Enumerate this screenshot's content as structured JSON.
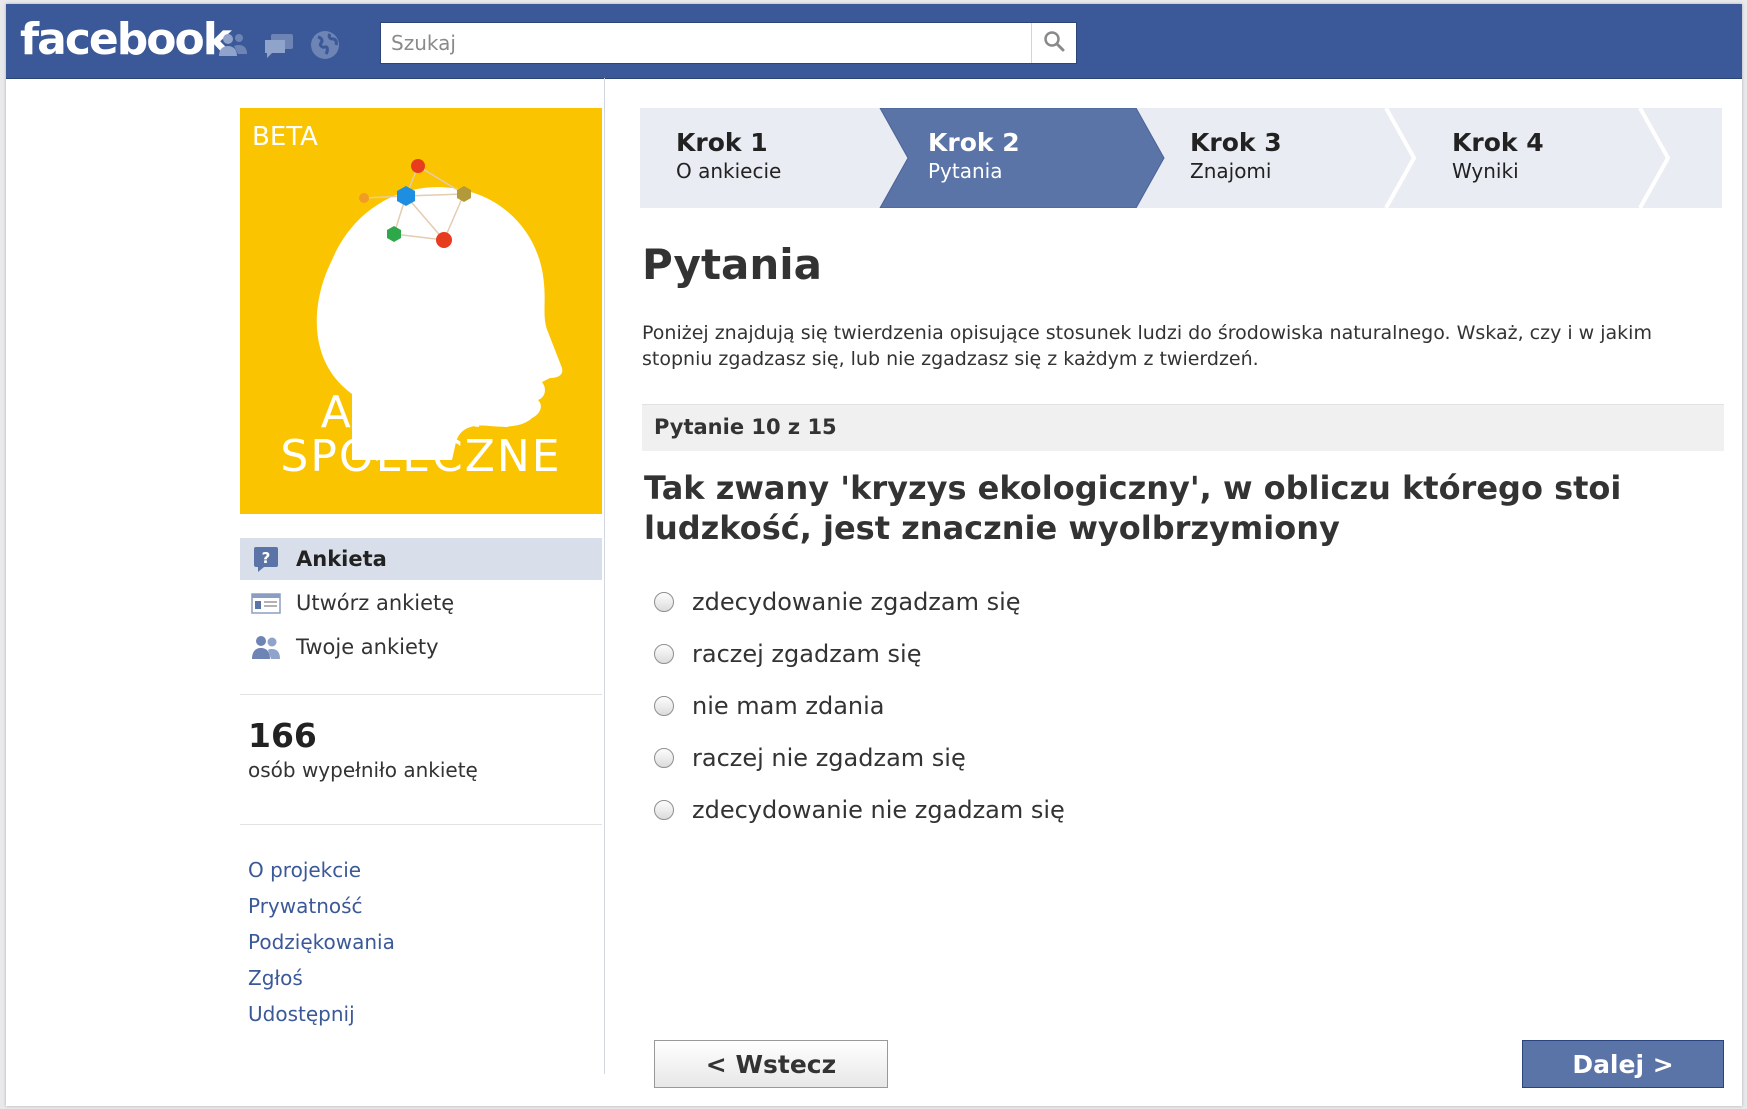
{
  "topbar": {
    "logo": "facebook",
    "search_placeholder": "Szukaj"
  },
  "app": {
    "beta": "BETA",
    "title_line1": "ANKIETY",
    "title_line2": "SPOŁECZNE"
  },
  "sidebar": {
    "items": [
      {
        "label": "Ankieta",
        "icon": "question-icon"
      },
      {
        "label": "Utwórz ankietę",
        "icon": "form-icon"
      },
      {
        "label": "Twoje ankiety",
        "icon": "users-icon"
      }
    ],
    "stats": {
      "count": "166",
      "label": "osób wypełniło ankietę"
    },
    "links": [
      "O projekcie",
      "Prywatność",
      "Podziękowania",
      "Zgłoś",
      "Udostępnij"
    ]
  },
  "steps": [
    {
      "title": "Krok 1",
      "subtitle": "O ankiecie",
      "active": false
    },
    {
      "title": "Krok 2",
      "subtitle": "Pytania",
      "active": true
    },
    {
      "title": "Krok 3",
      "subtitle": "Znajomi",
      "active": false
    },
    {
      "title": "Krok 4",
      "subtitle": "Wyniki",
      "active": false
    }
  ],
  "colors": {
    "brand": "#3b5998",
    "step_active": "#5b74a8",
    "cover": "#fbc400"
  },
  "main": {
    "heading": "Pytania",
    "intro": "Poniżej znajdują się twierdzenia opisujące stosunek ludzi do środowiska naturalnego. Wskaż, czy i w jakim stopniu zgadzasz się, lub nie zgadzasz się z każdym z twierdzeń.",
    "progress": "Pytanie 10 z 15",
    "question": "Tak zwany 'kryzys ekologiczny', w obliczu którego stoi ludzkość, jest znacznie wyolbrzymiony",
    "options": [
      "zdecydowanie zgadzam się",
      "raczej zgadzam się",
      "nie mam zdania",
      "raczej nie zgadzam się",
      "zdecydowanie nie zgadzam się"
    ],
    "back_label": "< Wstecz",
    "next_label": "Dalej >"
  }
}
